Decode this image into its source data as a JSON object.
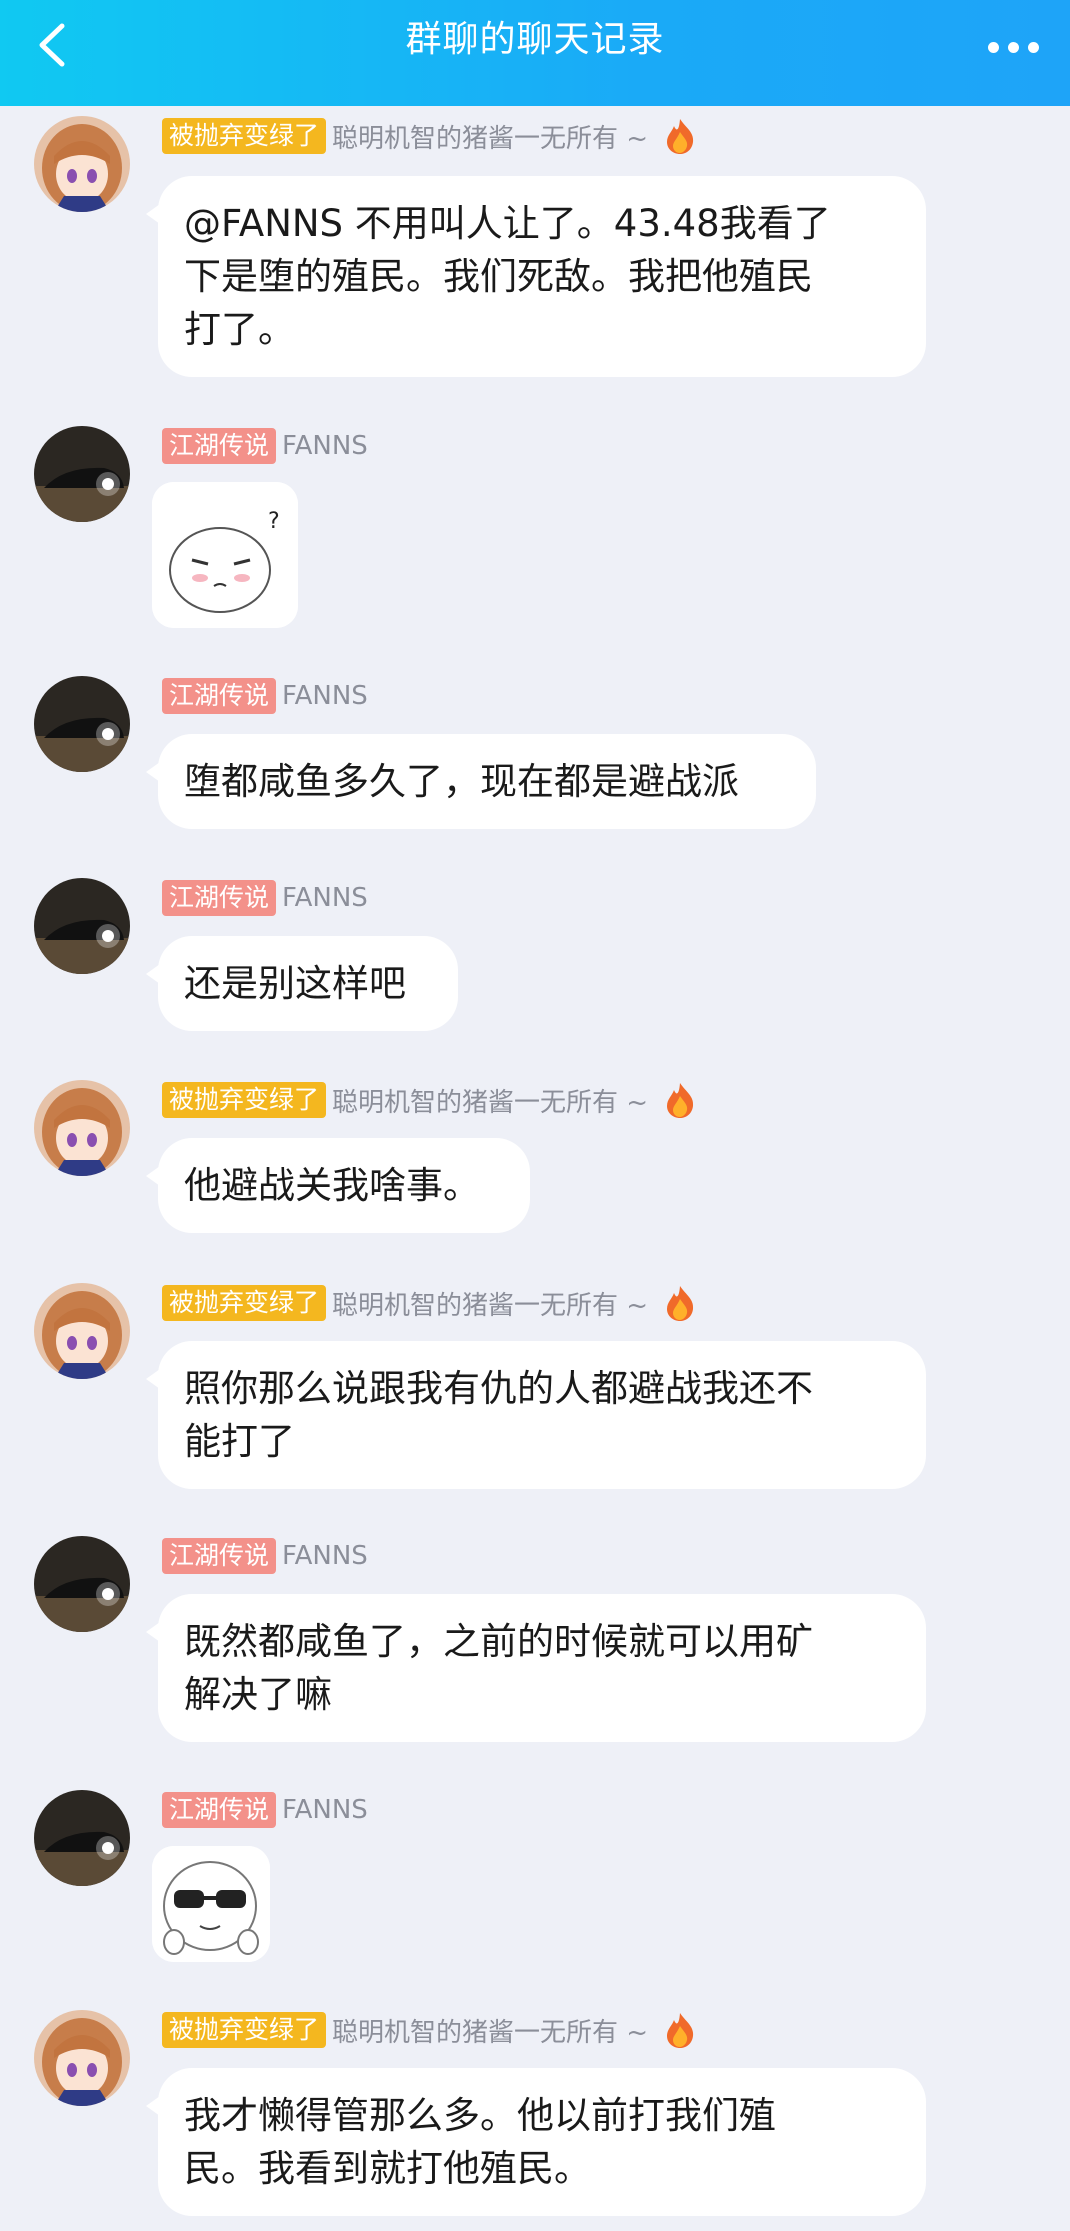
{
  "header": {
    "title": "群聊的聊天记录",
    "back_icon": "chevron-left-icon",
    "more_icon": "more-dots-icon",
    "gradient_start": "#10c9f2",
    "gradient_end": "#1ea4f8"
  },
  "users": {
    "u1": {
      "badge": "被抛弃变绿了",
      "name": "聪明机智的猪酱一无所有 ~",
      "badge_color": "#f4b71f",
      "avatar_icon": "anime-girl-avatar",
      "extra_icon": "flame-icon"
    },
    "u2": {
      "badge": "江湖传说",
      "name": "FANNS",
      "badge_color": "#f3918a",
      "avatar_icon": "car-headlights-avatar"
    }
  },
  "messages": [
    {
      "user": "u1",
      "badge": "被抛弃变绿了",
      "name": "聪明机智的猪酱一无所有 ~",
      "lines": [
        "@FANNS 不用叫人让了。43.48我看了",
        "下是堕的殖民。我们死敌。我把他殖民",
        "打了。"
      ]
    },
    {
      "user": "u2",
      "badge": "江湖传说",
      "name": "FANNS",
      "sticker": "confused-face-sticker"
    },
    {
      "user": "u2",
      "badge": "江湖传说",
      "name": "FANNS",
      "lines": [
        "堕都咸鱼多久了，现在都是避战派"
      ]
    },
    {
      "user": "u2",
      "badge": "江湖传说",
      "name": "FANNS",
      "lines": [
        "还是别这样吧"
      ]
    },
    {
      "user": "u1",
      "badge": "被抛弃变绿了",
      "name": "聪明机智的猪酱一无所有 ~",
      "lines": [
        "他避战关我啥事。"
      ]
    },
    {
      "user": "u1",
      "badge": "被抛弃变绿了",
      "name": "聪明机智的猪酱一无所有 ~",
      "lines": [
        "照你那么说跟我有仇的人都避战我还不",
        "能打了"
      ]
    },
    {
      "user": "u2",
      "badge": "江湖传说",
      "name": "FANNS",
      "lines": [
        "既然都咸鱼了，之前的时候就可以用矿",
        "解决了嘛"
      ]
    },
    {
      "user": "u2",
      "badge": "江湖传说",
      "name": "FANNS",
      "sticker": "sunglasses-face-sticker"
    },
    {
      "user": "u1",
      "badge": "被抛弃变绿了",
      "name": "聪明机智的猪酱一无所有 ~",
      "lines": [
        "我才懒得管那么多。他以前打我们殖",
        "民。我看到就打他殖民。"
      ]
    }
  ]
}
